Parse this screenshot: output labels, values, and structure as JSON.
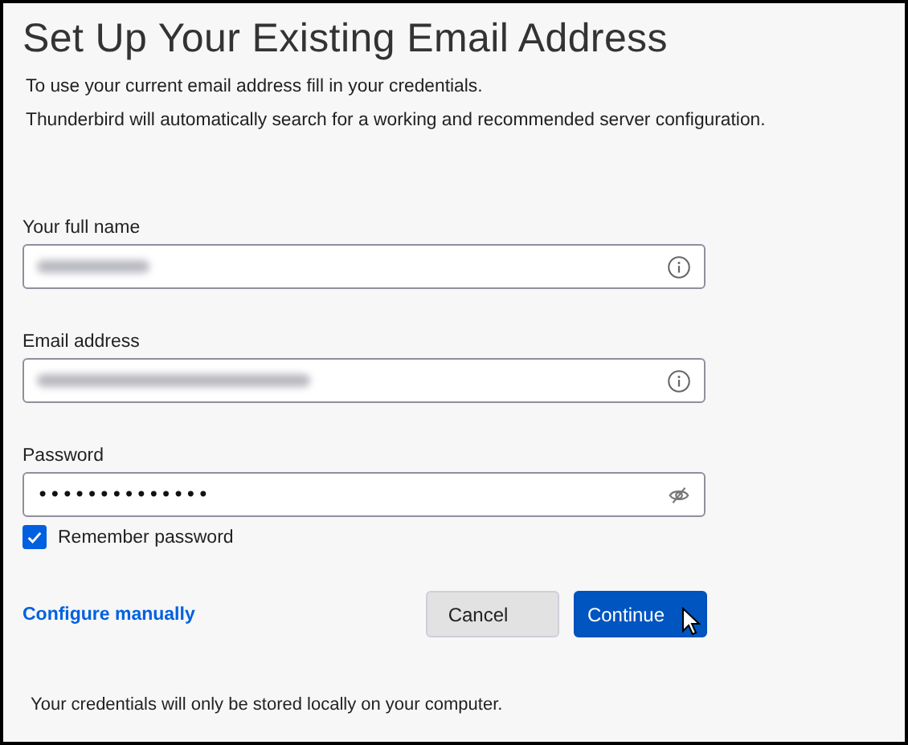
{
  "title": "Set Up Your Existing Email Address",
  "intro": [
    "To use your current email address fill in your credentials.",
    "Thunderbird will automatically search for a working and recommended server configuration."
  ],
  "fields": [
    {
      "label": "Your full name",
      "kind": "text",
      "blurred": true
    },
    {
      "label": "Email address",
      "kind": "text",
      "blurred": true
    },
    {
      "label": "Password",
      "kind": "password",
      "value": "••••••••••••••"
    }
  ],
  "remember": {
    "label": "Remember password",
    "checked": true
  },
  "configure_link": "Configure manually",
  "buttons": [
    {
      "label": "Cancel",
      "kind": "secondary"
    },
    {
      "label": "Continue",
      "kind": "primary",
      "hovered": true
    }
  ],
  "footer": "Your credentials will only be stored locally on your computer."
}
